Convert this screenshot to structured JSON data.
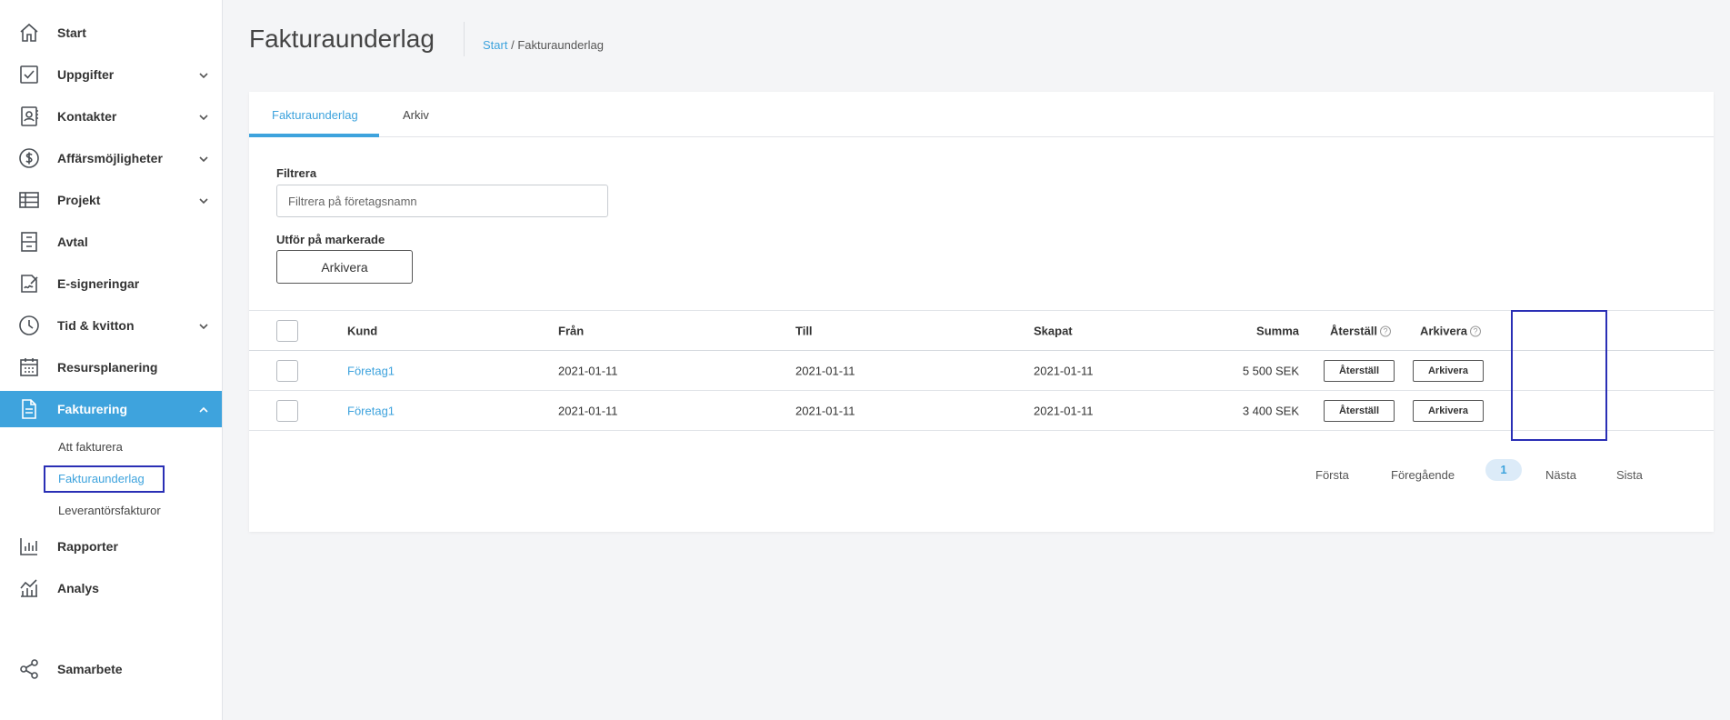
{
  "sidebar": {
    "items": [
      {
        "label": "Start",
        "icon": "home-icon"
      },
      {
        "label": "Uppgifter",
        "icon": "checkbox-icon"
      },
      {
        "label": "Kontakter",
        "icon": "contacts-icon"
      },
      {
        "label": "Affärsmöjligheter",
        "icon": "dollar-icon"
      },
      {
        "label": "Projekt",
        "icon": "table-icon"
      },
      {
        "label": "Avtal",
        "icon": "cabinet-icon"
      },
      {
        "label": "E-signeringar",
        "icon": "signature-icon"
      },
      {
        "label": "Tid & kvitton",
        "icon": "clock-icon"
      },
      {
        "label": "Resursplanering",
        "icon": "calendar-icon"
      },
      {
        "label": "Fakturering",
        "icon": "document-icon"
      },
      {
        "label": "Rapporter",
        "icon": "bar-chart-icon"
      },
      {
        "label": "Analys",
        "icon": "analytics-icon"
      },
      {
        "label": "Samarbete",
        "icon": "share-icon"
      }
    ],
    "sub_items": [
      {
        "label": "Att fakturera"
      },
      {
        "label": "Fakturaunderlag"
      },
      {
        "label": "Leverantörsfakturor"
      }
    ]
  },
  "header": {
    "title": "Fakturaunderlag",
    "breadcrumb_home": "Start",
    "breadcrumb_separator": " / ",
    "breadcrumb_current": "Fakturaunderlag"
  },
  "tabs": [
    {
      "label": "Fakturaunderlag"
    },
    {
      "label": "Arkiv"
    }
  ],
  "filter": {
    "label": "Filtrera",
    "placeholder": "Filtrera på företagsnamn"
  },
  "bulk": {
    "label": "Utför på markerade",
    "button": "Arkivera"
  },
  "table": {
    "columns": {
      "kund": "Kund",
      "fran": "Från",
      "till": "Till",
      "skapat": "Skapat",
      "summa": "Summa",
      "aterstall": "Återställ",
      "arkivera": "Arkivera"
    },
    "rows": [
      {
        "kund": "Företag1",
        "fran": "2021-01-11",
        "till": "2021-01-11",
        "skapat": "2021-01-11",
        "summa": "5 500 SEK",
        "aterstall_btn": "Återställ",
        "arkivera_btn": "Arkivera"
      },
      {
        "kund": "Företag1",
        "fran": "2021-01-11",
        "till": "2021-01-11",
        "skapat": "2021-01-11",
        "summa": "3 400 SEK",
        "aterstall_btn": "Återställ",
        "arkivera_btn": "Arkivera"
      }
    ]
  },
  "pagination": {
    "first": "Första",
    "prev": "Föregående",
    "current": "1",
    "next": "Nästa",
    "last": "Sista"
  },
  "colors": {
    "accent": "#3ea3dd",
    "highlight": "#2a2fb5"
  }
}
